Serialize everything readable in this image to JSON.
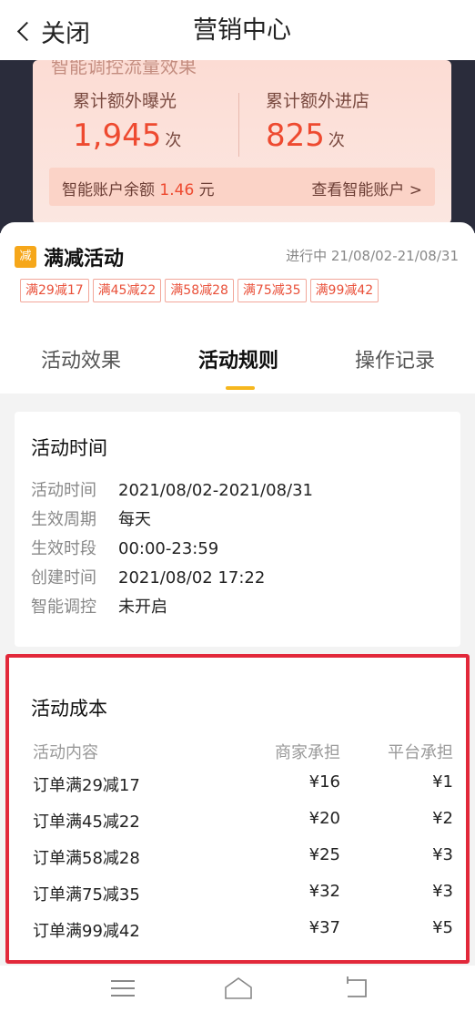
{
  "header": {
    "back_label": "关闭",
    "title": "营销中心"
  },
  "stats": {
    "peek_text": "智能调控流量效果",
    "exposure_label": "累计额外曝光",
    "exposure_value": "1,945",
    "exposure_unit": "次",
    "visits_label": "累计额外进店",
    "visits_value": "825",
    "visits_unit": "次",
    "account_label": "智能账户余额",
    "account_amount": "1.46",
    "account_unit": "元",
    "account_link": "查看智能账户 >"
  },
  "activity": {
    "icon_text": "减",
    "name": "满减活动",
    "status": "进行中 21/08/02-21/08/31",
    "tags": [
      "满29减17",
      "满45减22",
      "满58减28",
      "满75减35",
      "满99减42"
    ]
  },
  "tabs": [
    {
      "label": "活动效果",
      "active": false
    },
    {
      "label": "活动规则",
      "active": true
    },
    {
      "label": "操作记录",
      "active": false
    }
  ],
  "activity_time": {
    "title": "活动时间",
    "rows": [
      {
        "key": "活动时间",
        "value": "2021/08/02-2021/08/31"
      },
      {
        "key": "生效周期",
        "value": "每天"
      },
      {
        "key": "生效时段",
        "value": "00:00-23:59"
      },
      {
        "key": "创建时间",
        "value": "2021/08/02 17:22"
      },
      {
        "key": "智能调控",
        "value": "未开启"
      }
    ]
  },
  "activity_cost": {
    "title": "活动成本",
    "headers": [
      "活动内容",
      "商家承担",
      "平台承担"
    ],
    "rows": [
      [
        "订单满29减17",
        "¥16",
        "¥1"
      ],
      [
        "订单满45减22",
        "¥20",
        "¥2"
      ],
      [
        "订单满58减28",
        "¥25",
        "¥3"
      ],
      [
        "订单满75减35",
        "¥32",
        "¥3"
      ],
      [
        "订单满99减42",
        "¥37",
        "¥5"
      ]
    ],
    "highlight_color": "#e2283a"
  },
  "navbar": {
    "items": [
      "menu-icon",
      "home-icon",
      "back-icon"
    ]
  }
}
